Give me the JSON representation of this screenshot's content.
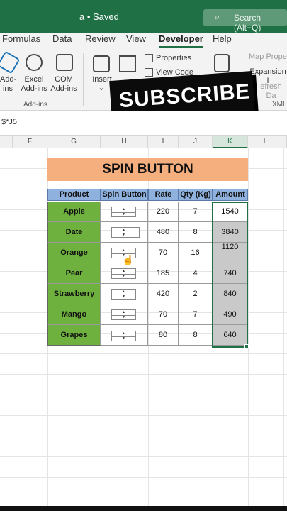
{
  "titlebar": {
    "title": "a • Saved",
    "search_icon": "search-icon",
    "search_text": "Search (Alt+Q)",
    "bg": "#1f7044"
  },
  "ribbon_tabs": [
    "Formulas",
    "Data",
    "Review",
    "View",
    "Developer",
    "Help"
  ],
  "active_tab": "Developer",
  "ribbon": {
    "addins": [
      "Add-\nins",
      "Excel\nAdd-ins",
      "COM\nAdd-ins"
    ],
    "addins_group": "Add-ins",
    "insert": "Insert",
    "properties": "Properties",
    "view_code": "View Code",
    "map_properties": "Map Prope",
    "expansion": "Expansion I",
    "refresh": "efresh Da",
    "xml_group": "XML"
  },
  "overlay": {
    "subscribe": "SUBSCRIBE"
  },
  "formula_bar": {
    "text": "$*J5"
  },
  "columns": [
    "F",
    "G",
    "H",
    "I",
    "J",
    "K",
    "L"
  ],
  "selected_column": "K",
  "sheet": {
    "banner": "SPIN BUTTON",
    "headers": [
      "Product",
      "Spin Button",
      "Rate",
      "Qty (Kg)",
      "Amount"
    ],
    "rows": [
      {
        "product": "Apple",
        "rate": "220",
        "qty": "7",
        "amount": "1540"
      },
      {
        "product": "Date",
        "rate": "480",
        "qty": "8",
        "amount": "3840"
      },
      {
        "product": "Orange",
        "rate": "70",
        "qty": "16",
        "amount": "1120"
      },
      {
        "product": "Pear",
        "rate": "185",
        "qty": "4",
        "amount": "740"
      },
      {
        "product": "Strawberry",
        "rate": "420",
        "qty": "2",
        "amount": "840"
      },
      {
        "product": "Mango",
        "rate": "70",
        "qty": "7",
        "amount": "490"
      },
      {
        "product": "Grapes",
        "rate": "80",
        "qty": "8",
        "amount": "640"
      }
    ]
  },
  "colors": {
    "banner": "#f5ae7e",
    "header": "#8fb1de",
    "product": "#6fb13e",
    "amount_selected": "#c9c9c9"
  }
}
